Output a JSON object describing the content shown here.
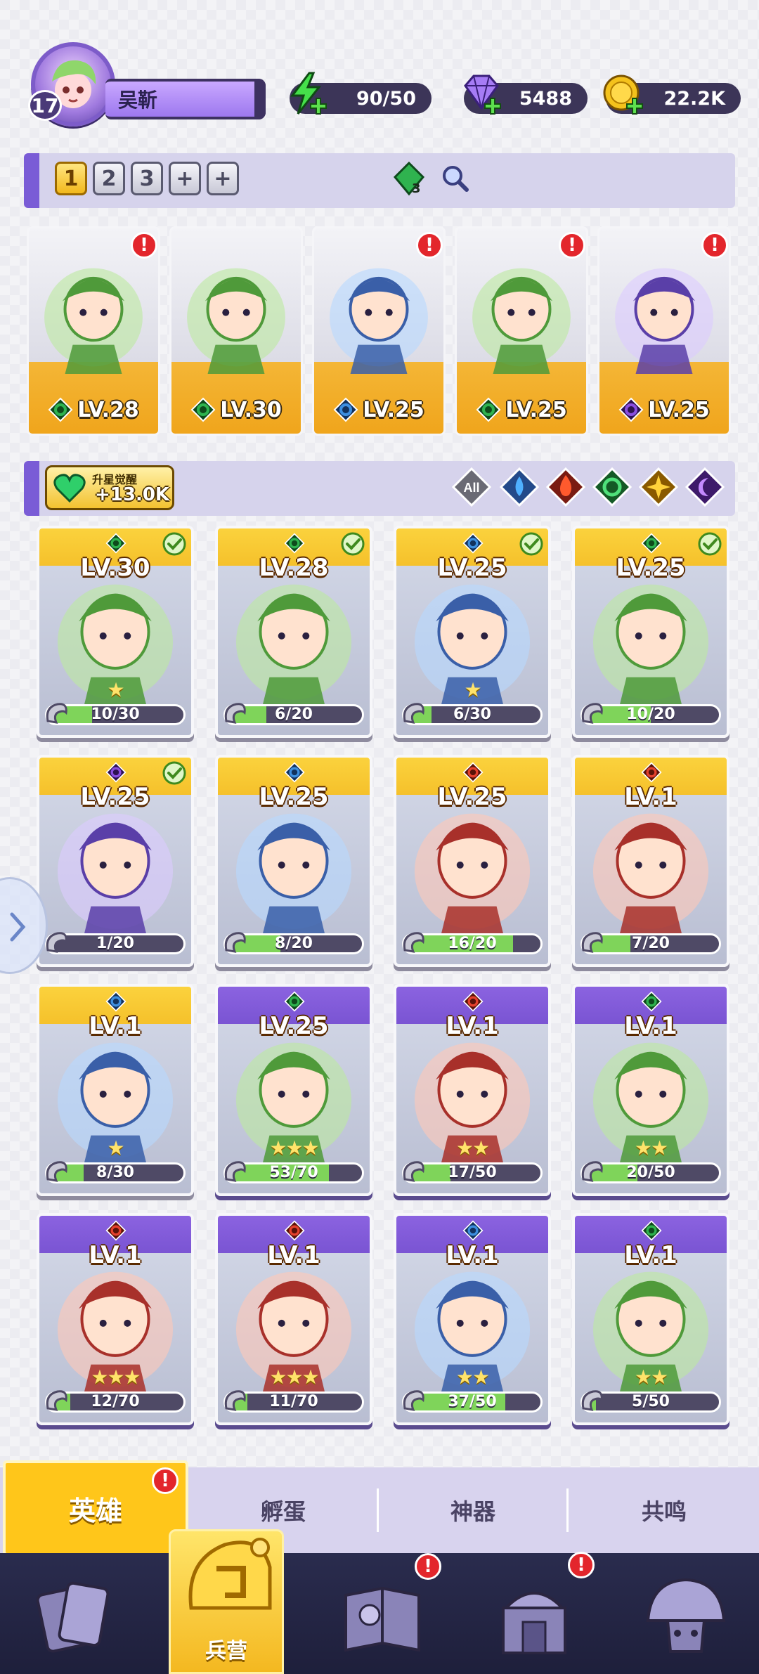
{
  "player": {
    "level": "17",
    "name": "吴靳"
  },
  "resources": {
    "energy": "90/50",
    "gems": "5488",
    "coins": "22.2K"
  },
  "team": {
    "slots": [
      "1",
      "2",
      "3",
      "+",
      "+"
    ],
    "active_slot": "1",
    "gem_count": "3",
    "members": [
      {
        "level": "LV.28",
        "element": "green",
        "alert": true
      },
      {
        "level": "LV.30",
        "element": "green",
        "alert": false
      },
      {
        "level": "LV.25",
        "element": "blue",
        "alert": true
      },
      {
        "level": "LV.25",
        "element": "green",
        "alert": true
      },
      {
        "level": "LV.25",
        "element": "purple",
        "alert": true
      }
    ]
  },
  "awaken": {
    "title": "升星觉醒",
    "value": "+13.0K"
  },
  "filters": [
    {
      "label": "All",
      "icon": "all-icon"
    },
    {
      "icon": "water-icon",
      "color": "#3d8fe0"
    },
    {
      "icon": "fire-icon",
      "color": "#e5412d"
    },
    {
      "icon": "nature-icon",
      "color": "#2fb34f"
    },
    {
      "icon": "light-icon",
      "color": "#f0b020"
    },
    {
      "icon": "dark-icon",
      "color": "#8a4fe0"
    }
  ],
  "heroes": [
    {
      "level": "LV.30",
      "element": "green",
      "shards": "10/30",
      "progress": 0.33,
      "frame": "gold",
      "check": true,
      "stars": "★"
    },
    {
      "level": "LV.28",
      "element": "green",
      "shards": "6/20",
      "progress": 0.3,
      "frame": "gold",
      "check": true,
      "stars": ""
    },
    {
      "level": "LV.25",
      "element": "blue",
      "shards": "6/30",
      "progress": 0.2,
      "frame": "gold",
      "check": true,
      "stars": "★"
    },
    {
      "level": "LV.25",
      "element": "green",
      "shards": "10/20",
      "progress": 0.5,
      "frame": "gold",
      "check": true,
      "stars": ""
    },
    {
      "level": "LV.25",
      "element": "purple",
      "shards": "1/20",
      "progress": 0.05,
      "frame": "gold",
      "check": true,
      "stars": ""
    },
    {
      "level": "LV.25",
      "element": "blue",
      "shards": "8/20",
      "progress": 0.4,
      "frame": "gold",
      "check": false,
      "stars": ""
    },
    {
      "level": "LV.25",
      "element": "red",
      "shards": "16/20",
      "progress": 0.8,
      "frame": "gold",
      "check": false,
      "stars": ""
    },
    {
      "level": "LV.1",
      "element": "red",
      "shards": "7/20",
      "progress": 0.35,
      "frame": "gold",
      "check": false,
      "stars": ""
    },
    {
      "level": "LV.1",
      "element": "blue",
      "shards": "8/30",
      "progress": 0.27,
      "frame": "gold",
      "check": false,
      "stars": "★"
    },
    {
      "level": "LV.25",
      "element": "green",
      "shards": "53/70",
      "progress": 0.76,
      "frame": "purple",
      "check": false,
      "stars": "★★★"
    },
    {
      "level": "LV.1",
      "element": "red",
      "shards": "17/50",
      "progress": 0.34,
      "frame": "purple",
      "check": false,
      "stars": "★★"
    },
    {
      "level": "LV.1",
      "element": "green",
      "shards": "20/50",
      "progress": 0.4,
      "frame": "purple",
      "check": false,
      "stars": "★★"
    },
    {
      "level": "LV.1",
      "element": "red",
      "shards": "12/70",
      "progress": 0.17,
      "frame": "purple",
      "check": false,
      "stars": "★★★"
    },
    {
      "level": "LV.1",
      "element": "red",
      "shards": "11/70",
      "progress": 0.16,
      "frame": "purple",
      "check": false,
      "stars": "★★★"
    },
    {
      "level": "LV.1",
      "element": "blue",
      "shards": "37/50",
      "progress": 0.74,
      "frame": "purple",
      "check": false,
      "stars": "★★"
    },
    {
      "level": "LV.1",
      "element": "green",
      "shards": "5/50",
      "progress": 0.1,
      "frame": "purple",
      "check": false,
      "stars": "★★"
    }
  ],
  "subtabs": {
    "heroes": "英雄",
    "hatch": "孵蛋",
    "artifact": "神器",
    "resonance": "共鸣"
  },
  "nav": {
    "barracks": "兵营"
  },
  "colors": {
    "accent_gold": "#ffc61a",
    "accent_purple": "#7a5cd6",
    "alert_red": "#e3262c"
  }
}
